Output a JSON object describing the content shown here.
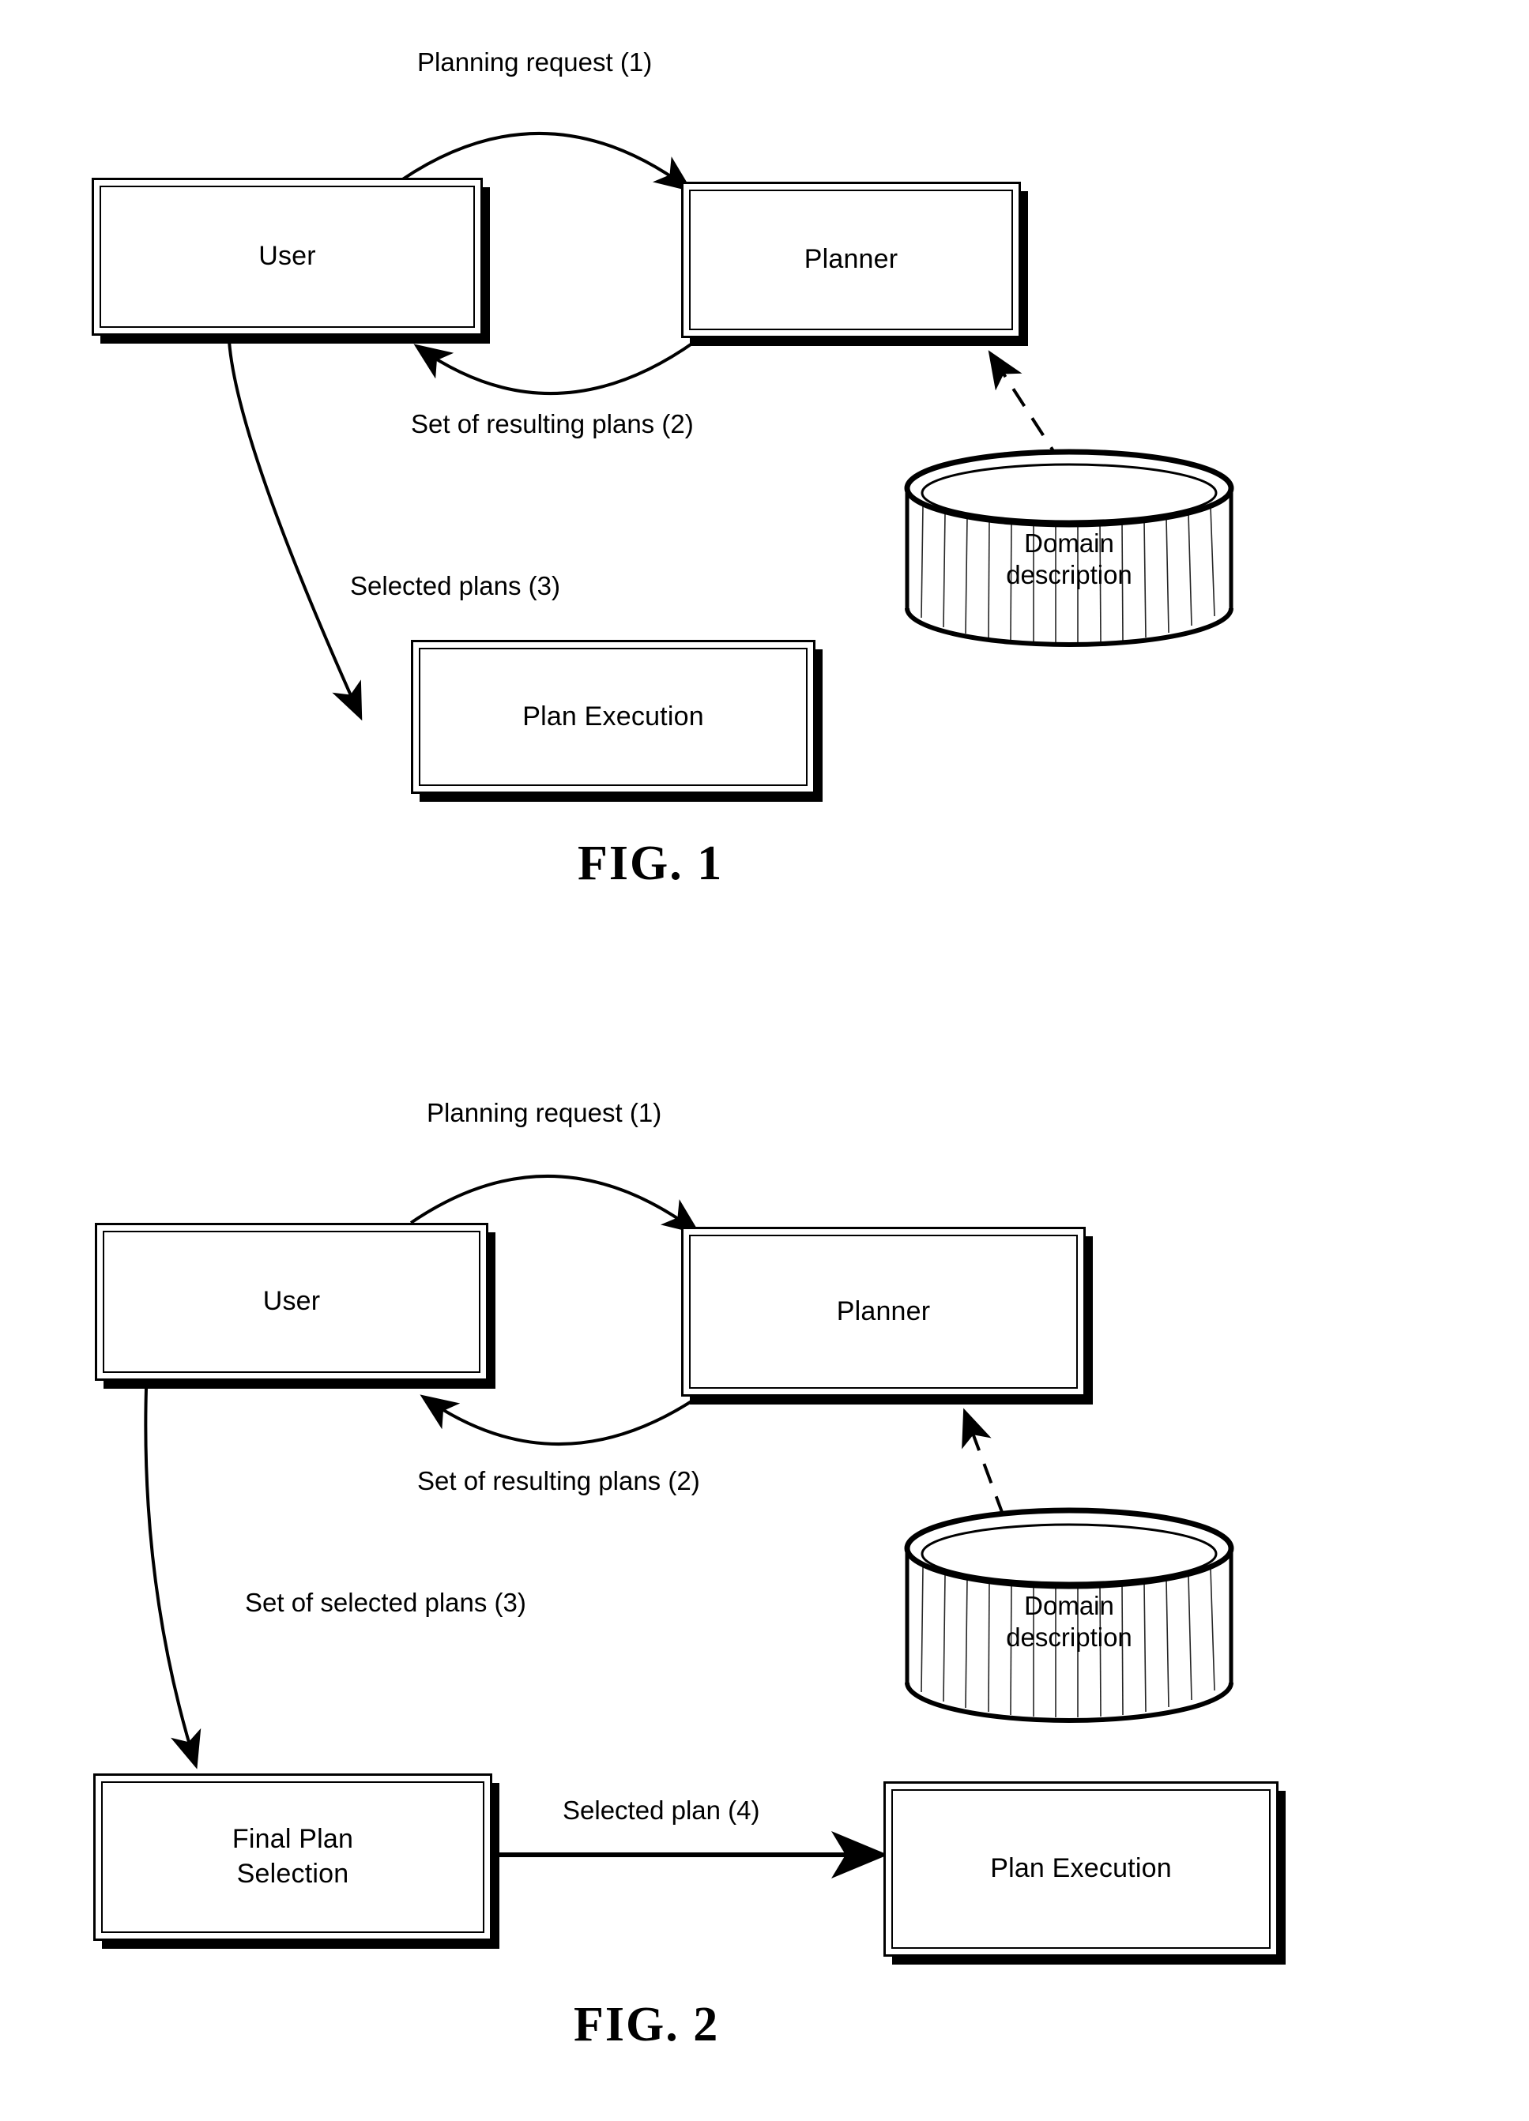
{
  "document": {
    "type": "patent-drawing-sheet",
    "figure_count": 2
  },
  "figure1": {
    "caption": "FIG. 1",
    "boxes": {
      "user": "User",
      "planner": "Planner",
      "plan_execution": "Plan Execution"
    },
    "datastore": {
      "label": "Domain\ndescription"
    },
    "edges": {
      "planning_request": "Planning request (1)",
      "resulting_plans": "Set of resulting plans (2)",
      "selected_plans": "Selected plans (3)"
    }
  },
  "figure2": {
    "caption": "FIG. 2",
    "boxes": {
      "user": "User",
      "planner": "Planner",
      "final_plan_selection": "Final Plan\nSelection",
      "plan_execution": "Plan Execution"
    },
    "datastore": {
      "label": "Domain\ndescription"
    },
    "edges": {
      "planning_request": "Planning request (1)",
      "resulting_plans": "Set of resulting plans (2)",
      "selected_plans": "Set of selected plans (3)",
      "selected_plan": "Selected plan (4)"
    }
  },
  "colors": {
    "ink": "#000000",
    "paper": "#ffffff"
  }
}
